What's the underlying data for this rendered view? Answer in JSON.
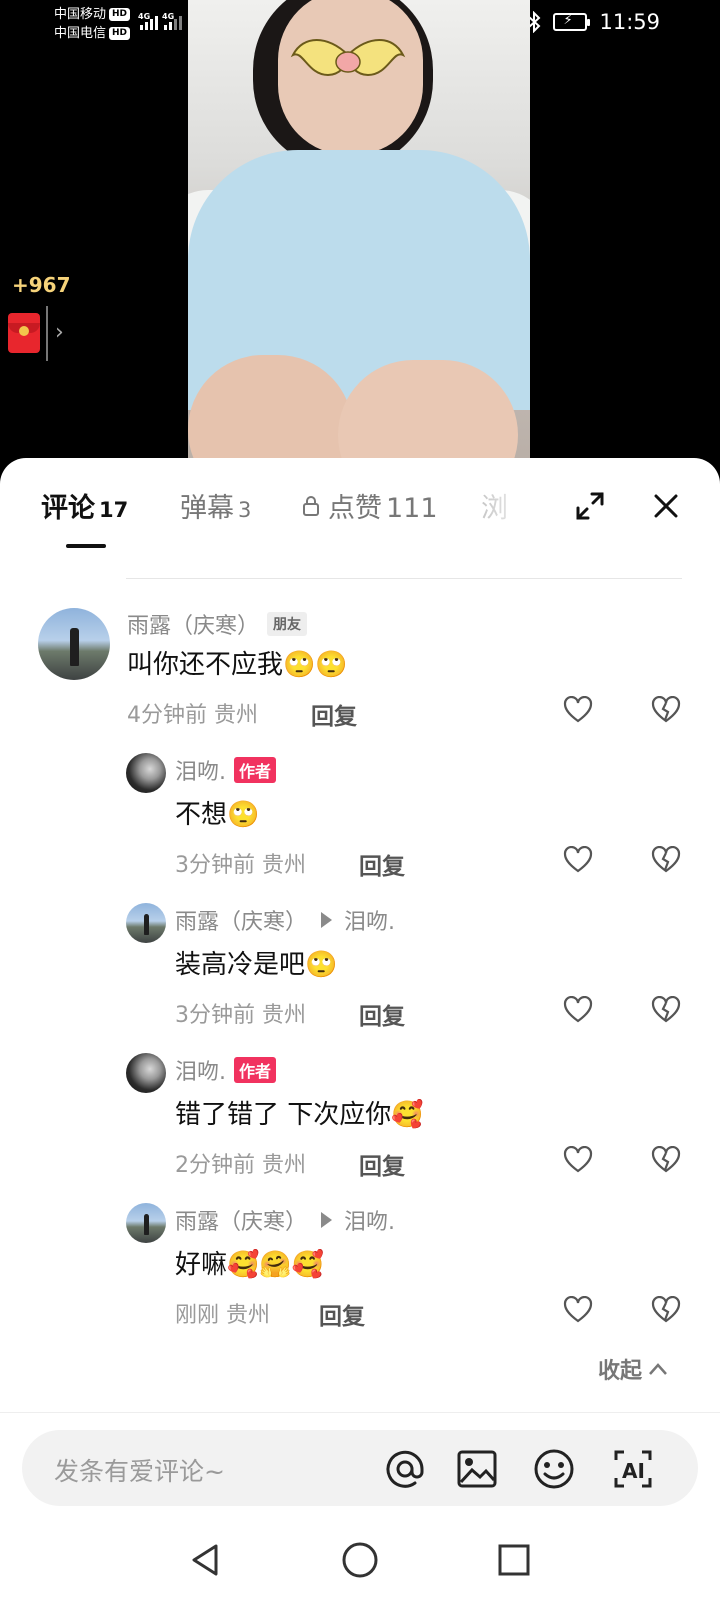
{
  "status_bar": {
    "carrier1": "中国移动",
    "carrier2": "中国电信",
    "hd": "HD",
    "net1": "4G",
    "net2": "4G",
    "time": "11:59"
  },
  "live": {
    "coins": "+967"
  },
  "tabs": [
    {
      "label": "评论",
      "count": "17"
    },
    {
      "label": "弹幕",
      "count": "3"
    },
    {
      "label": "点赞",
      "count": "111"
    },
    {
      "label": "浏",
      "count": ""
    }
  ],
  "comments": [
    {
      "user": "雨露（庆寒）",
      "badge": "朋友",
      "reply_to": "",
      "text": "叫你还不应我🙄🙄",
      "time": "4分钟前",
      "location": "贵州",
      "reply_label": "回复"
    },
    {
      "user": "泪吻.",
      "badge": "作者",
      "reply_to": "",
      "text": "不想🙄",
      "time": "3分钟前",
      "location": "贵州",
      "reply_label": "回复"
    },
    {
      "user": "雨露（庆寒）",
      "badge": "",
      "reply_to": "泪吻.",
      "text": "装高冷是吧🙄",
      "time": "3分钟前",
      "location": "贵州",
      "reply_label": "回复"
    },
    {
      "user": "泪吻.",
      "badge": "作者",
      "reply_to": "",
      "text": "错了错了 下次应你🥰",
      "time": "2分钟前",
      "location": "贵州",
      "reply_label": "回复"
    },
    {
      "user": "雨露（庆寒）",
      "badge": "",
      "reply_to": "泪吻.",
      "text": "好嘛🥰🤗🥰",
      "time": "刚刚",
      "location": "贵州",
      "reply_label": "回复"
    }
  ],
  "collapse_label": "收起",
  "input": {
    "placeholder": "发条有爱评论~"
  },
  "icons": {
    "expand": "expand-icon",
    "close": "close-icon",
    "like": "heart-icon",
    "dislike": "broken-heart-icon",
    "mention": "at-icon",
    "image": "image-icon",
    "emoji": "emoji-icon",
    "ai": "ai-icon",
    "back": "back-triangle-icon",
    "home": "home-circle-icon",
    "recents": "recents-square-icon"
  },
  "colors": {
    "author_badge": "#f1325f",
    "coin_text": "#f6d37a"
  }
}
